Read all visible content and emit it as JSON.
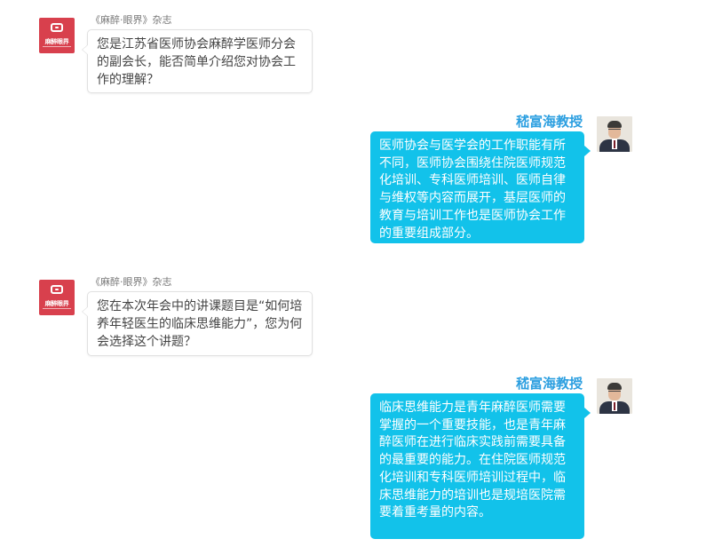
{
  "messages": [
    {
      "side": "left",
      "sender": "《麻醉·眼界》杂志",
      "logo_text": "麻醉眼界",
      "text": "您是江苏省医师协会麻醉学医师分会的副会长，能否简单介绍您对协会工作的理解？"
    },
    {
      "side": "right",
      "sender": "嵇富海教授",
      "text": "医师协会与医学会的工作职能有所不同，医师协会围绕住院医师规范化培训、专科医师培训、医师自律与维权等内容而展开，基层医师的教育与培训工作也是医师协会工作的重要组成部分。"
    },
    {
      "side": "left",
      "sender": "《麻醉·眼界》杂志",
      "logo_text": "麻醉眼界",
      "text": "您在本次年会中的讲课题目是“如何培养年轻医生的临床思维能力”，您为何会选择这个讲题？"
    },
    {
      "side": "right",
      "sender": "嵇富海教授",
      "text": "临床思维能力是青年麻醉医师需要掌握的一个重要技能，也是青年麻醉医师在进行临床实践前需要具备的最重要的能力。在住院医师规范化培训和专科医师培训过程中，临床思维能力的培训也是规培医院需要着重考量的内容。"
    }
  ],
  "colors": {
    "brand_red": "#d8404d",
    "reply_bubble": "#12c2ea",
    "reply_name": "#2c9fe0"
  },
  "icons": {
    "magazine_logo": "magazine-logo-icon",
    "professor_avatar": "professor-avatar"
  }
}
